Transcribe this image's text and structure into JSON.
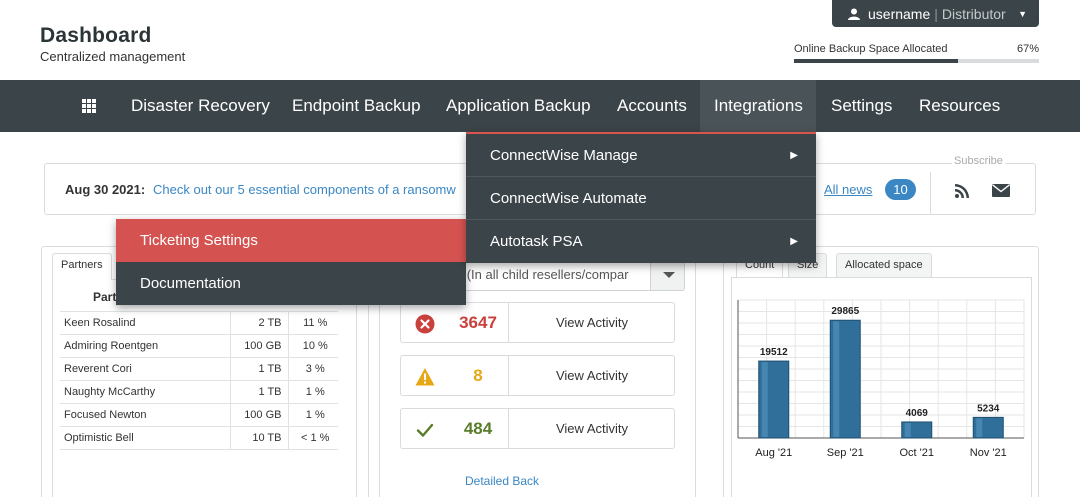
{
  "header": {
    "title": "Dashboard",
    "subtitle": "Centralized management",
    "user": {
      "name": "username",
      "separator": "|",
      "role": "Distributor"
    },
    "backup": {
      "label": "Online Backup Space Allocated",
      "percent_text": "67%",
      "percent": 67
    }
  },
  "nav": {
    "items": [
      "Disaster Recovery",
      "Endpoint Backup",
      "Application Backup",
      "Accounts",
      "Integrations",
      "Settings",
      "Resources"
    ],
    "active": "Integrations"
  },
  "integrations_menu": {
    "items": [
      {
        "label": "ConnectWise Manage",
        "has_submenu": true
      },
      {
        "label": "ConnectWise Automate",
        "has_submenu": false
      },
      {
        "label": "Autotask PSA",
        "has_submenu": true
      }
    ]
  },
  "submenu": {
    "items": [
      {
        "label": "Ticketing Settings",
        "active": true
      },
      {
        "label": "Documentation",
        "active": false
      }
    ]
  },
  "news": {
    "date": "Aug 30 2021:",
    "headline": "Check out our 5 essential components of a ransomw",
    "all_news": "All news",
    "count": "10",
    "subscribe": "Subscribe"
  },
  "partners": {
    "tab": "Partners",
    "column_header": "Part",
    "rows": [
      {
        "name": "Keen Rosalind",
        "size": "2 TB",
        "pct": "11 %"
      },
      {
        "name": "Admiring Roentgen",
        "size": "100 GB",
        "pct": "10 %"
      },
      {
        "name": "Reverent Cori",
        "size": "1 TB",
        "pct": "3 %"
      },
      {
        "name": "Naughty McCarthy",
        "size": "1 TB",
        "pct": "1 %"
      },
      {
        "name": "Focused Newton",
        "size": "100 GB",
        "pct": "1 %"
      },
      {
        "name": "Optimistic Bell",
        "size": "10 TB",
        "pct": "< 1 %"
      }
    ]
  },
  "activity": {
    "filter": "ts (In all child resellers/compar",
    "items": [
      {
        "count": "3647",
        "label": "View Activity",
        "icon": "error-icon",
        "color": "#c9403d"
      },
      {
        "count": "8",
        "label": "View Activity",
        "icon": "warning-icon",
        "color": "#e6a817"
      },
      {
        "count": "484",
        "label": "View Activity",
        "icon": "check-icon",
        "color": "#5a7d2a"
      }
    ],
    "detail_link": "Detailed Back"
  },
  "chart_tabs": [
    "Count",
    "Size",
    "Allocated space"
  ],
  "chart_data": {
    "type": "bar",
    "categories": [
      "Aug '21",
      "Sep '21",
      "Oct '21",
      "Nov '21"
    ],
    "values": [
      19512,
      29865,
      4069,
      5234
    ],
    "ylim": [
      0,
      35000
    ],
    "grid": true,
    "bar_color": "#2f6f99"
  },
  "colors": {
    "nav_bg": "#3b4448",
    "accent_red": "#d45351",
    "link_blue": "#3a87c4"
  }
}
